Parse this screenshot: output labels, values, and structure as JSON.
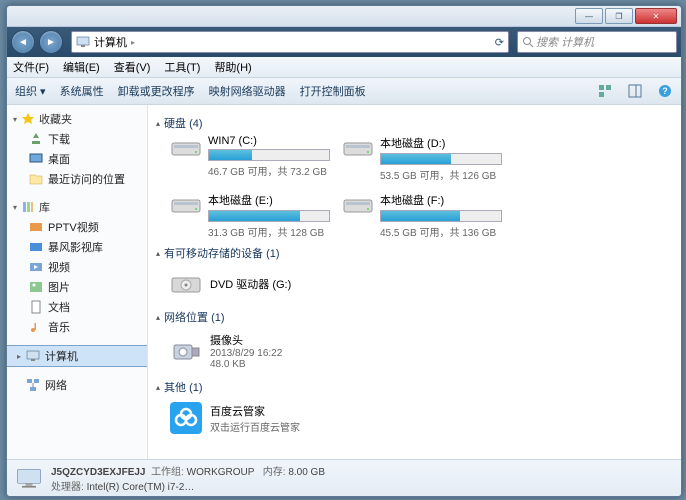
{
  "title_controls": {
    "min": "—",
    "max": "❐",
    "close": "✕"
  },
  "nav": {
    "back": "◄",
    "forward": "►",
    "breadcrumb_icon": "computer",
    "breadcrumb": "计算机",
    "refresh": "⟳",
    "search_placeholder": "搜索 计算机",
    "dropdown": "▸"
  },
  "menubar": [
    "文件(F)",
    "编辑(E)",
    "查看(V)",
    "工具(T)",
    "帮助(H)"
  ],
  "toolbar": {
    "organize": "组织 ▾",
    "items": [
      "系统属性",
      "卸载或更改程序",
      "映射网络驱动器",
      "打开控制面板"
    ]
  },
  "sidebar": {
    "favorites": {
      "label": "收藏夹",
      "items": [
        "下载",
        "桌面",
        "最近访问的位置"
      ]
    },
    "libraries": {
      "label": "库",
      "items": [
        "PPTV视频",
        "暴风影视库",
        "视频",
        "图片",
        "文档",
        "音乐"
      ]
    },
    "computer": {
      "label": "计算机"
    },
    "network": {
      "label": "网络"
    }
  },
  "sections": {
    "drives": {
      "title": "硬盘 (4)",
      "items": [
        {
          "name": "WIN7 (C:)",
          "free": "46.7 GB 可用，共 73.2 GB",
          "pct": 36
        },
        {
          "name": "本地磁盘 (D:)",
          "free": "53.5 GB 可用，共 126 GB",
          "pct": 58
        },
        {
          "name": "本地磁盘 (E:)",
          "free": "31.3 GB 可用，共 128 GB",
          "pct": 76
        },
        {
          "name": "本地磁盘 (F:)",
          "free": "45.5 GB 可用，共 136 GB",
          "pct": 66
        }
      ]
    },
    "removable": {
      "title": "有可移动存储的设备 (1)",
      "items": [
        {
          "name": "DVD 驱动器 (G:)"
        }
      ]
    },
    "netloc": {
      "title": "网络位置 (1)",
      "items": [
        {
          "name": "摄像头",
          "line2": "2013/8/29 16:22",
          "line3": "48.0 KB"
        }
      ]
    },
    "other": {
      "title": "其他 (1)",
      "items": [
        {
          "name": "百度云管家",
          "line2": "双击运行百度云管家"
        }
      ]
    }
  },
  "status": {
    "name": "J5QZCYD3EXJFEJJ",
    "workgroup_k": "工作组:",
    "workgroup_v": "WORKGROUP",
    "mem_k": "内存:",
    "mem_v": "8.00 GB",
    "cpu_k": "处理器:",
    "cpu_v": "Intel(R) Core(TM) i7-2…"
  }
}
